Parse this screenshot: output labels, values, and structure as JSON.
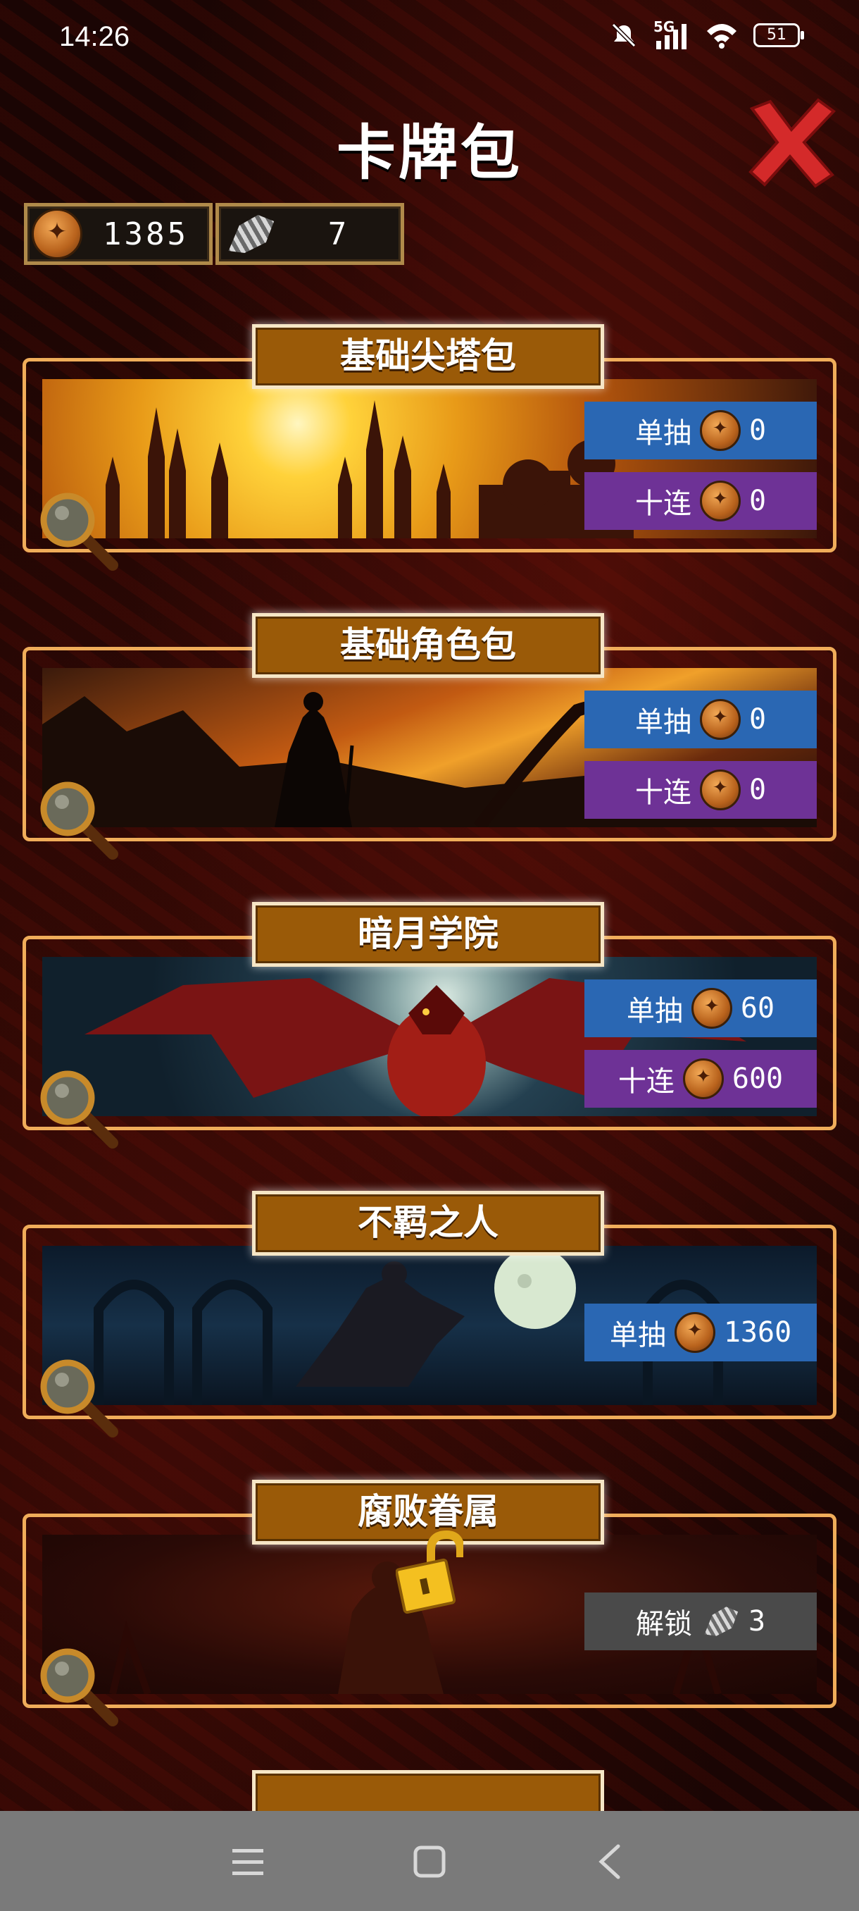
{
  "status_bar": {
    "time": "14:26",
    "network": "5G",
    "battery": "51"
  },
  "header": {
    "title": "卡牌包"
  },
  "currency": {
    "coins": "1385",
    "shards": "7"
  },
  "packs": [
    {
      "title": "基础尖塔包",
      "single_label": "单抽",
      "single_price": "0",
      "ten_label": "十连",
      "ten_price": "0"
    },
    {
      "title": "基础角色包",
      "single_label": "单抽",
      "single_price": "0",
      "ten_label": "十连",
      "ten_price": "0"
    },
    {
      "title": "暗月学院",
      "single_label": "单抽",
      "single_price": "60",
      "ten_label": "十连",
      "ten_price": "600"
    },
    {
      "title": "不羁之人",
      "single_label": "单抽",
      "single_price": "1360"
    },
    {
      "title": "腐败眷属",
      "unlock_label": "解锁",
      "unlock_price": "3"
    }
  ],
  "colors": {
    "accent_frame": "#f0ad5a",
    "title_plate": "#9a5a08",
    "btn_single": "#2a67b3",
    "btn_ten": "#6e3296",
    "btn_locked": "#4a4a4a",
    "close": "#d42a2a"
  }
}
